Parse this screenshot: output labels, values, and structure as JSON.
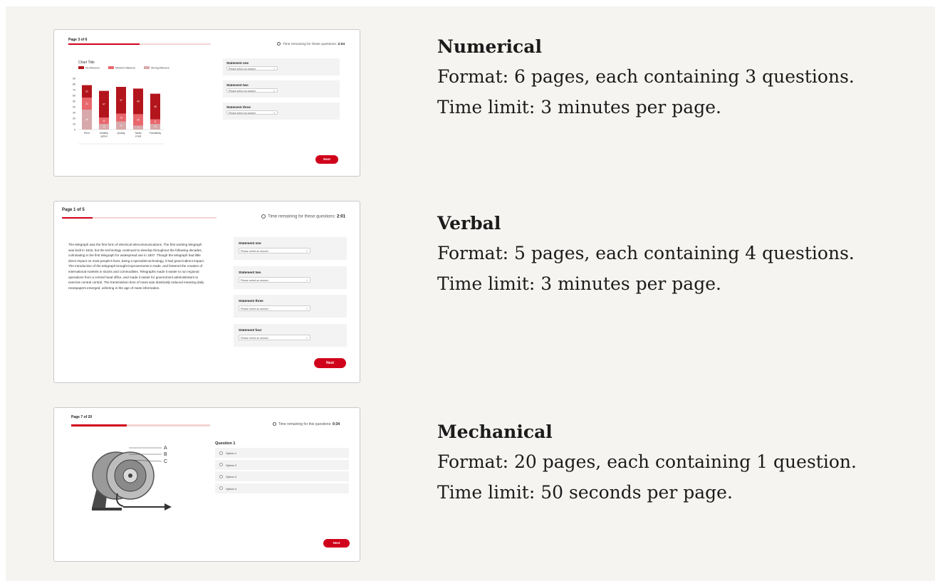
{
  "sections": [
    {
      "title": "Numerical",
      "format": "Format: 6 pages, each containing 3 questions.",
      "time_limit": "Time limit: 3 minutes per page.",
      "preview": {
        "page_label": "Page 3 of 6",
        "progress": 0.5,
        "timer_text": "Time remaining for these questions:",
        "timer_value": "2:04",
        "chart_data": {
          "type": "bar",
          "stacked": true,
          "title": "Chart Title",
          "categories": [
            "Price",
            "Healthy option",
            "Quality",
            "Taste/ smell",
            "Familiarity"
          ],
          "series": [
            {
              "name": "No influence",
              "color": "#b3151c",
              "values": [
                22,
                47,
                47,
                45,
                45
              ]
            },
            {
              "name": "Medium influence",
              "color": "#e8676d",
              "values": [
                21,
                11,
                14,
                20,
                8
              ]
            },
            {
              "name": "Strong influence",
              "color": "#d8a9aa",
              "values": [
                35,
                10,
                14,
                7,
                10
              ]
            }
          ],
          "ylim": [
            0,
            90
          ],
          "yticks": [
            "0",
            "10",
            "20",
            "30",
            "40",
            "50",
            "60",
            "70",
            "80",
            "90"
          ],
          "data_labels": [
            [
              "22",
              "21",
              "35"
            ],
            [
              "47",
              "11",
              "10"
            ],
            [
              "47",
              "14",
              "14"
            ],
            [
              "45",
              "20",
              "7"
            ],
            [
              "45",
              "8",
              "10"
            ]
          ]
        },
        "statements": [
          {
            "title": "Statement one",
            "placeholder": "Please select an answer"
          },
          {
            "title": "Statement two",
            "placeholder": "Please select an answer"
          },
          {
            "title": "Statement three",
            "placeholder": "Please select an answer"
          }
        ],
        "next_label": "Next"
      }
    },
    {
      "title": "Verbal",
      "format": "Format: 5 pages, each containing 4 questions.",
      "time_limit": "Time limit: 3 minutes per page.",
      "preview": {
        "page_label": "Page 1 of 5",
        "progress": 0.2,
        "timer_text": "Time remaining for these questions:",
        "timer_value": "2:01",
        "passage": "The telegraph was the first form of electrical telecommunications. The first working telegraph was built in 1816, but the technology continued to develop throughout the following decades, culminating in the first telegraph for widespread use in 1837. Though the telegraph had little direct impact on most people's lives, being a specialist technology, it had great indirect impact. The introduction of the telegraph brought improvements in trade, and fostered the creation of international markets in stocks and commodities. Telegraphs made it easier to run regional operations from a central head office, and made it easier for government administrators to exercise central control. The transmission time of news was drastically reduced meaning daily newspapers emerged, ushering in the age of mass information.",
        "statements": [
          {
            "title": "Statement one",
            "placeholder": "Please select an answer"
          },
          {
            "title": "Statement two",
            "placeholder": "Please select an answer"
          },
          {
            "title": "Statement three",
            "placeholder": "Please select an answer"
          },
          {
            "title": "Statement four",
            "placeholder": "Please select an answer"
          }
        ],
        "next_label": "Next"
      }
    },
    {
      "title": "Mechanical",
      "format": "Format: 20 pages, each containing 1 question.",
      "time_limit": "Time limit: 50 seconds per page.",
      "preview": {
        "page_label": "Page 7 of 20",
        "progress": 0.4,
        "timer_text": "Time remaining for this questions:",
        "timer_value": "0:34",
        "diagram_labels": [
          "A",
          "B",
          "C"
        ],
        "question_title": "Question 1",
        "options": [
          "Option 1",
          "Option 2",
          "Option 3",
          "Option 4"
        ],
        "next_label": "Next"
      }
    }
  ]
}
